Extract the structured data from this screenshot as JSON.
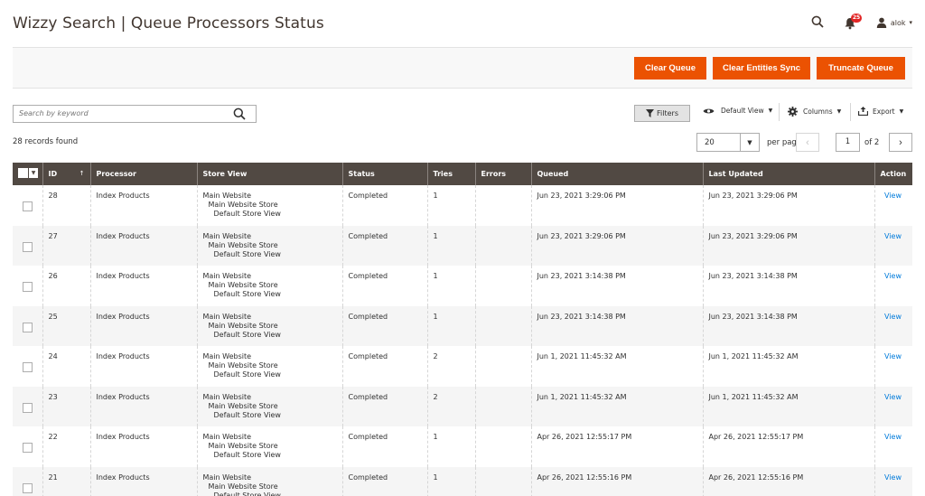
{
  "header": {
    "title": "Wizzy Search | Queue Processors Status",
    "notification_count": "25",
    "user_name": "alok"
  },
  "actions": {
    "clear_queue": "Clear Queue",
    "clear_entities_sync": "Clear Entities Sync",
    "truncate_queue": "Truncate Queue"
  },
  "toolbar": {
    "search_placeholder": "Search by keyword",
    "filters": "Filters",
    "default_view": "Default View",
    "columns": "Columns",
    "export": "Export"
  },
  "records_found": "28 records found",
  "pagination": {
    "per_page_value": "20",
    "per_page_label": "per page",
    "current_page": "1",
    "total_label": "of 2"
  },
  "columns": [
    "ID",
    "Processor",
    "Store View",
    "Status",
    "Tries",
    "Errors",
    "Queued",
    "Last Updated",
    "Action"
  ],
  "rows": [
    {
      "id": "28",
      "processor": "Index Products",
      "store1": "Main Website",
      "store2": "Main Website Store",
      "store3": "Default Store View",
      "status": "Completed",
      "tries": "1",
      "errors": "",
      "queued": "Jun 23, 2021 3:29:06 PM",
      "updated": "Jun 23, 2021 3:29:06 PM",
      "action": "View"
    },
    {
      "id": "27",
      "processor": "Index Products",
      "store1": "Main Website",
      "store2": "Main Website Store",
      "store3": "Default Store View",
      "status": "Completed",
      "tries": "1",
      "errors": "",
      "queued": "Jun 23, 2021 3:29:06 PM",
      "updated": "Jun 23, 2021 3:29:06 PM",
      "action": "View"
    },
    {
      "id": "26",
      "processor": "Index Products",
      "store1": "Main Website",
      "store2": "Main Website Store",
      "store3": "Default Store View",
      "status": "Completed",
      "tries": "1",
      "errors": "",
      "queued": "Jun 23, 2021 3:14:38 PM",
      "updated": "Jun 23, 2021 3:14:38 PM",
      "action": "View"
    },
    {
      "id": "25",
      "processor": "Index Products",
      "store1": "Main Website",
      "store2": "Main Website Store",
      "store3": "Default Store View",
      "status": "Completed",
      "tries": "1",
      "errors": "",
      "queued": "Jun 23, 2021 3:14:38 PM",
      "updated": "Jun 23, 2021 3:14:38 PM",
      "action": "View"
    },
    {
      "id": "24",
      "processor": "Index Products",
      "store1": "Main Website",
      "store2": "Main Website Store",
      "store3": "Default Store View",
      "status": "Completed",
      "tries": "2",
      "errors": "",
      "queued": "Jun 1, 2021 11:45:32 AM",
      "updated": "Jun 1, 2021 11:45:32 AM",
      "action": "View"
    },
    {
      "id": "23",
      "processor": "Index Products",
      "store1": "Main Website",
      "store2": "Main Website Store",
      "store3": "Default Store View",
      "status": "Completed",
      "tries": "2",
      "errors": "",
      "queued": "Jun 1, 2021 11:45:32 AM",
      "updated": "Jun 1, 2021 11:45:32 AM",
      "action": "View"
    },
    {
      "id": "22",
      "processor": "Index Products",
      "store1": "Main Website",
      "store2": "Main Website Store",
      "store3": "Default Store View",
      "status": "Completed",
      "tries": "1",
      "errors": "",
      "queued": "Apr 26, 2021 12:55:17 PM",
      "updated": "Apr 26, 2021 12:55:17 PM",
      "action": "View"
    },
    {
      "id": "21",
      "processor": "Index Products",
      "store1": "Main Website",
      "store2": "Main Website Store",
      "store3": "Default Store View",
      "status": "Completed",
      "tries": "1",
      "errors": "",
      "queued": "Apr 26, 2021 12:55:16 PM",
      "updated": "Apr 26, 2021 12:55:16 PM",
      "action": "View"
    }
  ],
  "colors": {
    "accent": "#eb5202",
    "grid_header": "#514943",
    "link": "#007bdb",
    "notification": "#e22626"
  }
}
